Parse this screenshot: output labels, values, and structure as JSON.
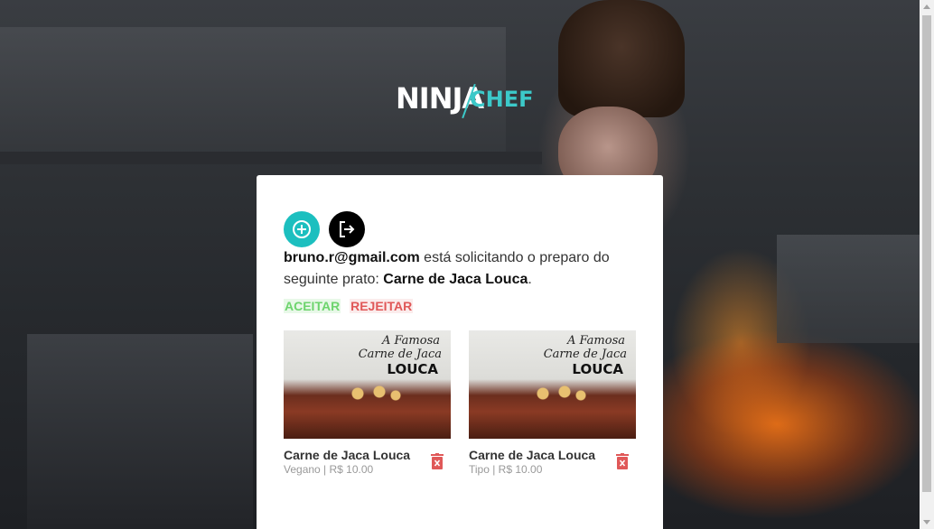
{
  "logo": {
    "part1": "NINJA",
    "part2": "CHEF"
  },
  "colors": {
    "accent": "#1cbfbf",
    "accept": "#6dd46d",
    "reject": "#e05858"
  },
  "toolbar": {
    "add_icon": "plus-circle-icon",
    "logout_icon": "logout-icon"
  },
  "request": {
    "email": "bruno.r@gmail.com",
    "text_middle": " está solicitando o preparo do seguinte prato: ",
    "dish": "Carne de Jaca Louca",
    "end": "."
  },
  "actions": {
    "accept": "ACEITAR",
    "reject": "REJEITAR"
  },
  "dishes": [
    {
      "image_line1": "A Famosa",
      "image_line2": "Carne de Jaca",
      "image_line3": "LOUCA",
      "name": "Carne de Jaca Louca",
      "meta": "Vegano | R$ 10.00"
    },
    {
      "image_line1": "A Famosa",
      "image_line2": "Carne de Jaca",
      "image_line3": "LOUCA",
      "name": "Carne de Jaca Louca",
      "meta": "Tipo | R$ 10.00"
    }
  ]
}
